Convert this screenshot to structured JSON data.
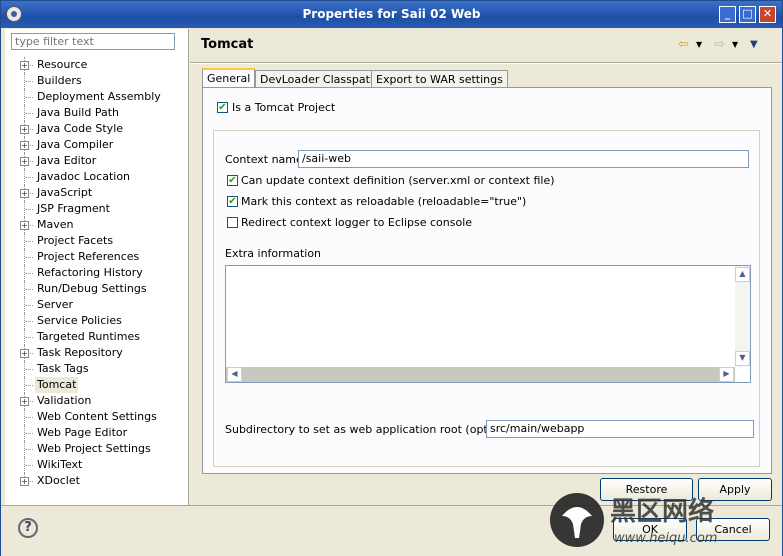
{
  "window": {
    "title": "Properties for Saii 02 Web"
  },
  "filter": {
    "placeholder": "type filter text"
  },
  "tree": [
    {
      "label": "Resource",
      "expandable": true
    },
    {
      "label": "Builders",
      "expandable": false
    },
    {
      "label": "Deployment Assembly",
      "expandable": false
    },
    {
      "label": "Java Build Path",
      "expandable": false
    },
    {
      "label": "Java Code Style",
      "expandable": true
    },
    {
      "label": "Java Compiler",
      "expandable": true
    },
    {
      "label": "Java Editor",
      "expandable": true
    },
    {
      "label": "Javadoc Location",
      "expandable": false
    },
    {
      "label": "JavaScript",
      "expandable": true
    },
    {
      "label": "JSP Fragment",
      "expandable": false
    },
    {
      "label": "Maven",
      "expandable": true
    },
    {
      "label": "Project Facets",
      "expandable": false
    },
    {
      "label": "Project References",
      "expandable": false
    },
    {
      "label": "Refactoring History",
      "expandable": false
    },
    {
      "label": "Run/Debug Settings",
      "expandable": false
    },
    {
      "label": "Server",
      "expandable": false
    },
    {
      "label": "Service Policies",
      "expandable": false
    },
    {
      "label": "Targeted Runtimes",
      "expandable": false
    },
    {
      "label": "Task Repository",
      "expandable": true
    },
    {
      "label": "Task Tags",
      "expandable": false
    },
    {
      "label": "Tomcat",
      "expandable": false,
      "selected": true
    },
    {
      "label": "Validation",
      "expandable": true
    },
    {
      "label": "Web Content Settings",
      "expandable": false
    },
    {
      "label": "Web Page Editor",
      "expandable": false
    },
    {
      "label": "Web Project Settings",
      "expandable": false
    },
    {
      "label": "WikiText",
      "expandable": false
    },
    {
      "label": "XDoclet",
      "expandable": true
    }
  ],
  "page": {
    "title": "Tomcat",
    "tabs": [
      "General",
      "DevLoader Classpath",
      "Export to WAR settings"
    ],
    "is_tomcat_project": {
      "label": "Is a Tomcat Project",
      "checked": true
    },
    "context_name": {
      "label": "Context name",
      "value": "/saii-web"
    },
    "can_update": {
      "label": "Can update context definition (server.xml or context file)",
      "checked": true
    },
    "reloadable": {
      "label": "Mark this context as reloadable (reloadable=\"true\")",
      "checked": true
    },
    "redirect_logger": {
      "label": "Redirect context logger to Eclipse console",
      "checked": false
    },
    "extra_info": {
      "label": "Extra information",
      "value": ""
    },
    "subdir": {
      "label": "Subdirectory to set as web application root (optional)",
      "value": "src/main/webapp"
    }
  },
  "buttons": {
    "restore_defaults": "Restore Defaults",
    "apply": "Apply",
    "ok": "OK",
    "cancel": "Cancel"
  },
  "watermark": {
    "main": "黑区网络",
    "url": "www.heiqu.com"
  }
}
